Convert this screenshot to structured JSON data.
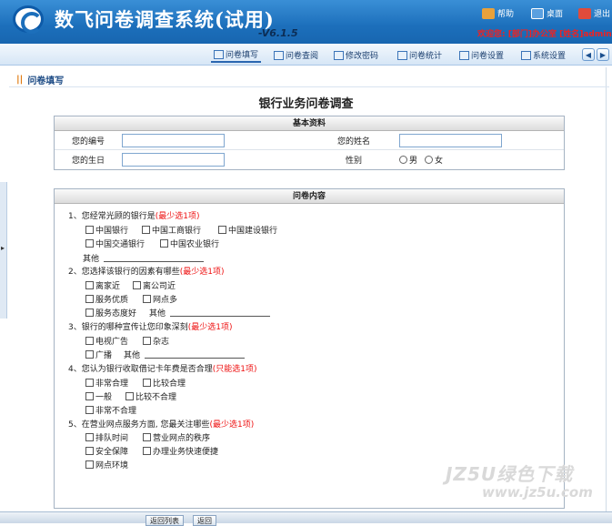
{
  "header": {
    "app_title": "数飞问卷调查系统(试用)",
    "version": "-V6.1.5",
    "links": [
      {
        "label": "帮助",
        "icon": "help-icon",
        "color": "#e8a13b"
      },
      {
        "label": "桌面",
        "icon": "desktop-icon",
        "color": "#5aa0e0"
      },
      {
        "label": "退出",
        "icon": "exit-icon",
        "color": "#e14b3b"
      }
    ],
    "welcome": "欢迎您: [部门]办公室 [姓名]admin"
  },
  "nav": {
    "items": [
      {
        "label": "问卷填写",
        "icon": "envelope-icon",
        "active": true
      },
      {
        "label": "问卷查阅",
        "icon": "mail-icon",
        "active": false
      },
      {
        "label": "修改密码",
        "icon": "edit-icon",
        "active": false
      },
      {
        "label": "问卷统计",
        "icon": "chart-icon",
        "active": false
      },
      {
        "label": "问卷设置",
        "icon": "settings-icon",
        "active": false
      },
      {
        "label": "系统设置",
        "icon": "system-icon",
        "active": false
      }
    ],
    "prev": "◀",
    "next": "▶"
  },
  "breadcrumb": {
    "mark": "||",
    "label": "问卷填写"
  },
  "survey": {
    "title": "银行业务问卷调查",
    "basic": {
      "header": "基本资料",
      "id_label": "您的编号",
      "name_label": "您的姓名",
      "birth_label": "您的生日",
      "gender_label": "性别",
      "male": "男",
      "female": "女"
    },
    "content": {
      "header": "问卷内容",
      "questions": [
        {
          "text": "1、您经常光顾的银行是",
          "req": "(最少选1项)",
          "options": [
            "中国银行",
            "中国工商银行",
            "中国建设银行",
            "中国交通银行",
            "中国农业银行"
          ],
          "other": "其他"
        },
        {
          "text": "2、您选择该银行的因素有哪些",
          "req": "(最少选1项)",
          "options": [
            "离家近",
            "离公司近",
            "服务优质",
            "网点多",
            "服务态度好"
          ],
          "other": "其他"
        },
        {
          "text": "3、银行的哪种宣传让您印象深刻",
          "req": "(最少选1项)",
          "options": [
            "电视广告",
            "杂志",
            "广播"
          ],
          "other": "其他"
        },
        {
          "text": "4、您认为银行收取借记卡年费是否合理",
          "req": "(只能选1项)",
          "options": [
            "非常合理",
            "比较合理",
            "一般",
            "比较不合理",
            "非常不合理"
          ]
        },
        {
          "text": "5、在营业网点服务方面, 您最关注哪些",
          "req": "(最少选1项)",
          "options": [
            "排队时间",
            "营业网点的秩序",
            "安全保障",
            "办理业务快速便捷",
            "网点环境"
          ]
        }
      ]
    }
  },
  "footer": {
    "back_list": "返回列表",
    "back": "返回"
  },
  "watermark": {
    "line1": "JZ5U绿色下载",
    "line2": "www.jz5u.com"
  }
}
